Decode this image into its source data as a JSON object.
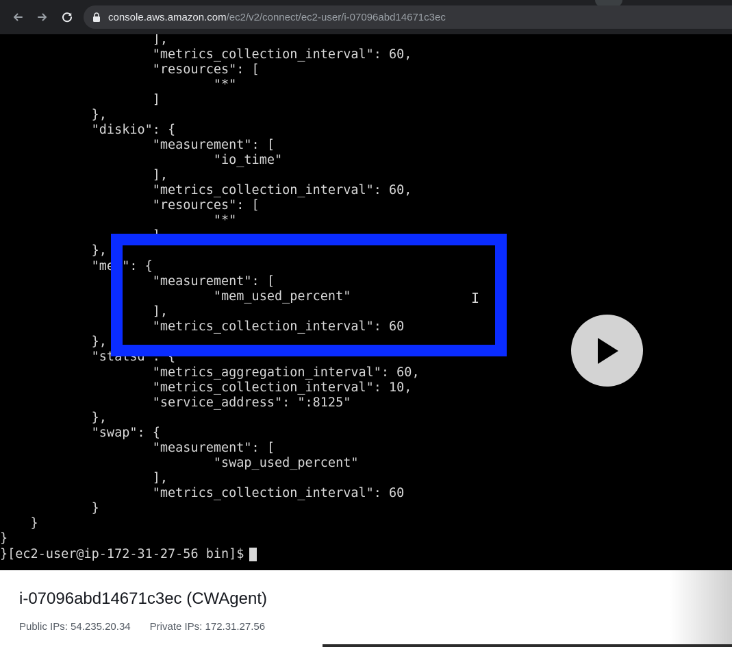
{
  "browser": {
    "back_icon": "arrow-left-icon",
    "forward_icon": "arrow-right-icon",
    "reload_icon": "reload-icon",
    "lock_icon": "lock-icon",
    "url_host": "console.aws.amazon.com",
    "url_path": "/ec2/v2/connect/ec2-user/i-07096abd14671c3ec"
  },
  "terminal": {
    "lines": [
      "                    ],",
      "                    \"metrics_collection_interval\": 60,",
      "                    \"resources\": [",
      "                            \"*\"",
      "                    ]",
      "            },",
      "            \"diskio\": {",
      "                    \"measurement\": [",
      "                            \"io_time\"",
      "                    ],",
      "                    \"metrics_collection_interval\": 60,",
      "                    \"resources\": [",
      "                            \"*\"",
      "                    ]",
      "            },",
      "            \"mem\": {",
      "                    \"measurement\": [",
      "                            \"mem_used_percent\"",
      "                    ],",
      "                    \"metrics_collection_interval\": 60",
      "            },",
      "            \"statsd\": {",
      "                    \"metrics_aggregation_interval\": 60,",
      "                    \"metrics_collection_interval\": 10,",
      "                    \"service_address\": \":8125\"",
      "            },",
      "            \"swap\": {",
      "                    \"measurement\": [",
      "                            \"swap_used_percent\"",
      "                    ],",
      "                    \"metrics_collection_interval\": 60",
      "            }",
      "    }",
      "}"
    ],
    "prompt": "}[ec2-user@ip-172-31-27-56 bin]$",
    "cursor_icon": "text-cursor-icon"
  },
  "overlay": {
    "highlight_color": "#0a2cff",
    "play_icon": "play-icon"
  },
  "instance": {
    "title": "i-07096abd14671c3ec (CWAgent)",
    "public_ips_label": "Public IPs:",
    "public_ips": "54.235.20.34",
    "private_ips_label": "Private IPs:",
    "private_ips": "172.31.27.56"
  }
}
